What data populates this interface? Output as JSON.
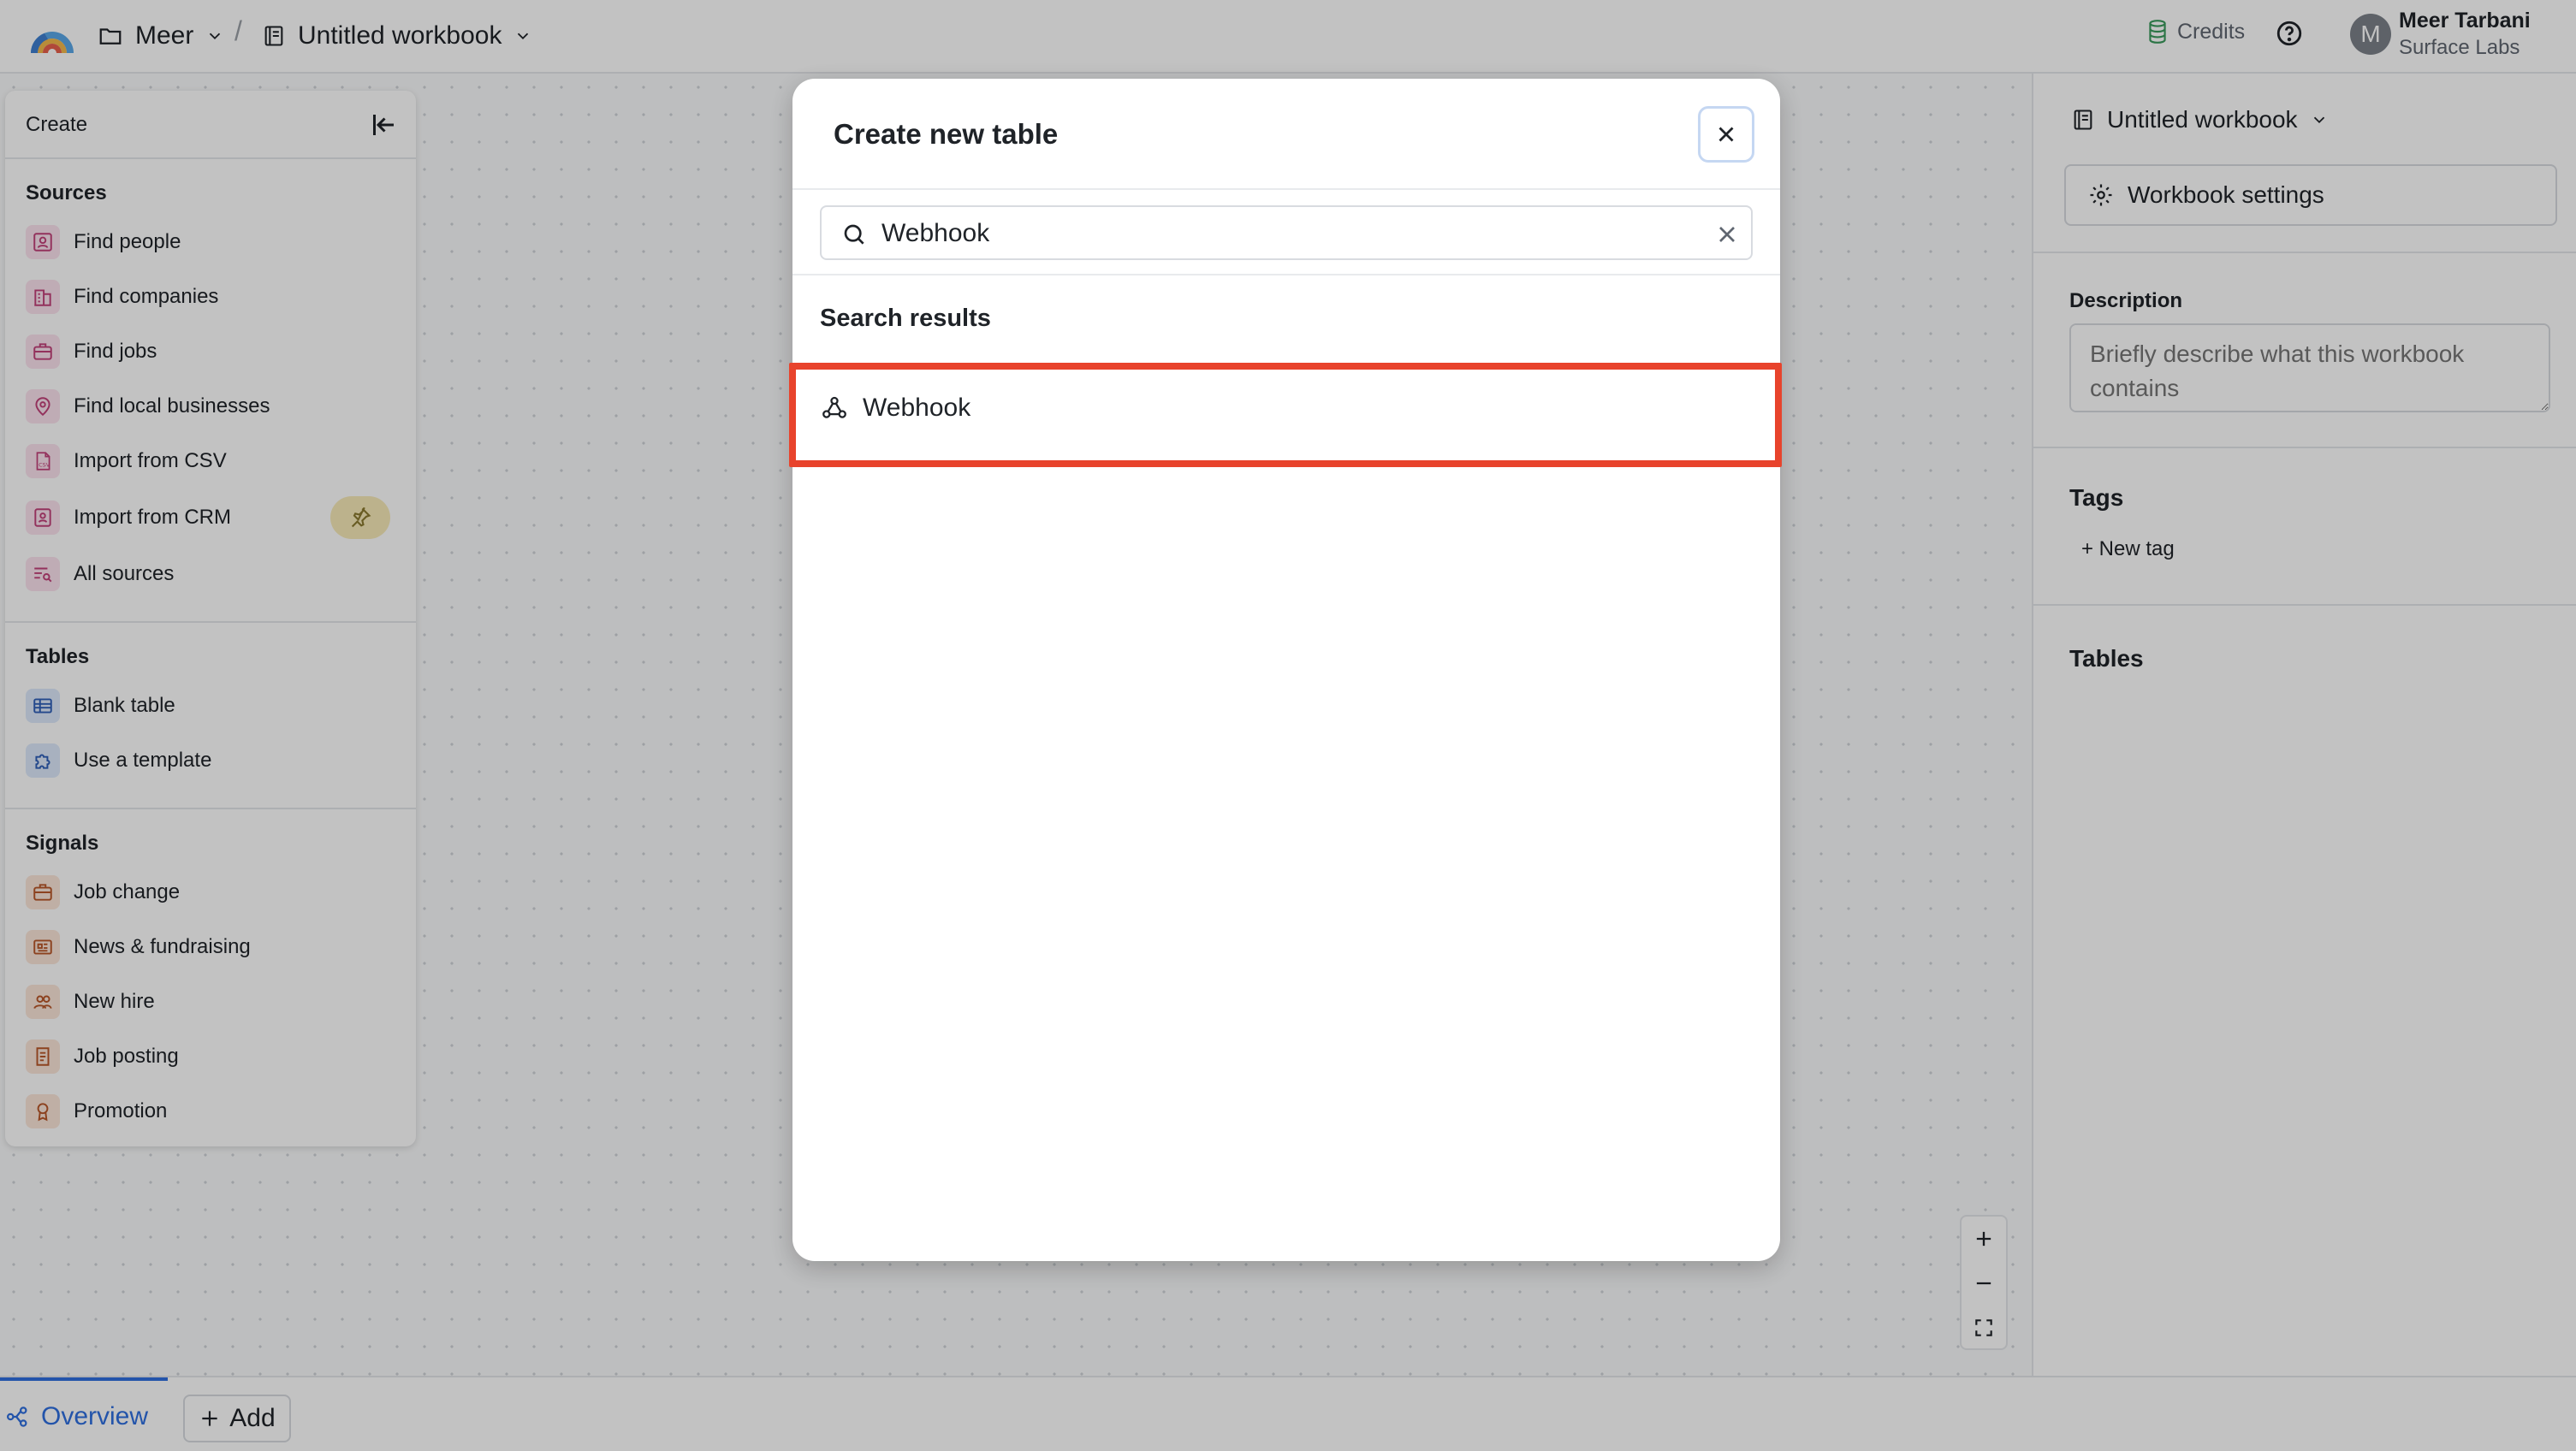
{
  "header": {
    "folder_name": "Meer",
    "separator": "/",
    "workbook_name": "Untitled workbook",
    "credits_label": "Credits",
    "user_initial": "M",
    "user_name": "Meer Tarbani",
    "user_org": "Surface Labs"
  },
  "create_panel": {
    "title": "Create",
    "sections": {
      "sources": {
        "title": "Sources",
        "items": [
          {
            "label": "Find people",
            "icon": "person-icon"
          },
          {
            "label": "Find companies",
            "icon": "building-icon"
          },
          {
            "label": "Find jobs",
            "icon": "briefcase-icon"
          },
          {
            "label": "Find local businesses",
            "icon": "map-pin-icon"
          },
          {
            "label": "Import from CSV",
            "icon": "csv-file-icon"
          },
          {
            "label": "Import from CRM",
            "icon": "crm-icon"
          },
          {
            "label": "All sources",
            "icon": "list-search-icon"
          }
        ]
      },
      "tables": {
        "title": "Tables",
        "items": [
          {
            "label": "Blank table",
            "icon": "table-icon"
          },
          {
            "label": "Use a template",
            "icon": "puzzle-icon"
          }
        ]
      },
      "signals": {
        "title": "Signals",
        "items": [
          {
            "label": "Job change",
            "icon": "briefcase-icon"
          },
          {
            "label": "News & fundraising",
            "icon": "newspaper-icon"
          },
          {
            "label": "New hire",
            "icon": "users-icon"
          },
          {
            "label": "Job posting",
            "icon": "document-icon"
          },
          {
            "label": "Promotion",
            "icon": "award-icon"
          }
        ]
      }
    }
  },
  "modal": {
    "title": "Create new table",
    "search_value": "Webhook",
    "results_title": "Search results",
    "results": [
      {
        "label": "Webhook",
        "icon": "webhook-icon"
      }
    ]
  },
  "right_panel": {
    "workbook_name": "Untitled workbook",
    "settings_label": "Workbook settings",
    "description_label": "Description",
    "description_placeholder": "Briefly describe what this workbook contains",
    "tags_title": "Tags",
    "new_tag_label": "+ New tag",
    "tables_title": "Tables"
  },
  "bottom_bar": {
    "overview_label": "Overview",
    "add_label": "Add"
  },
  "colors": {
    "accent_blue": "#2f6fe0",
    "highlight_red": "#e8432c",
    "pin_badge": "#f7eab8"
  }
}
